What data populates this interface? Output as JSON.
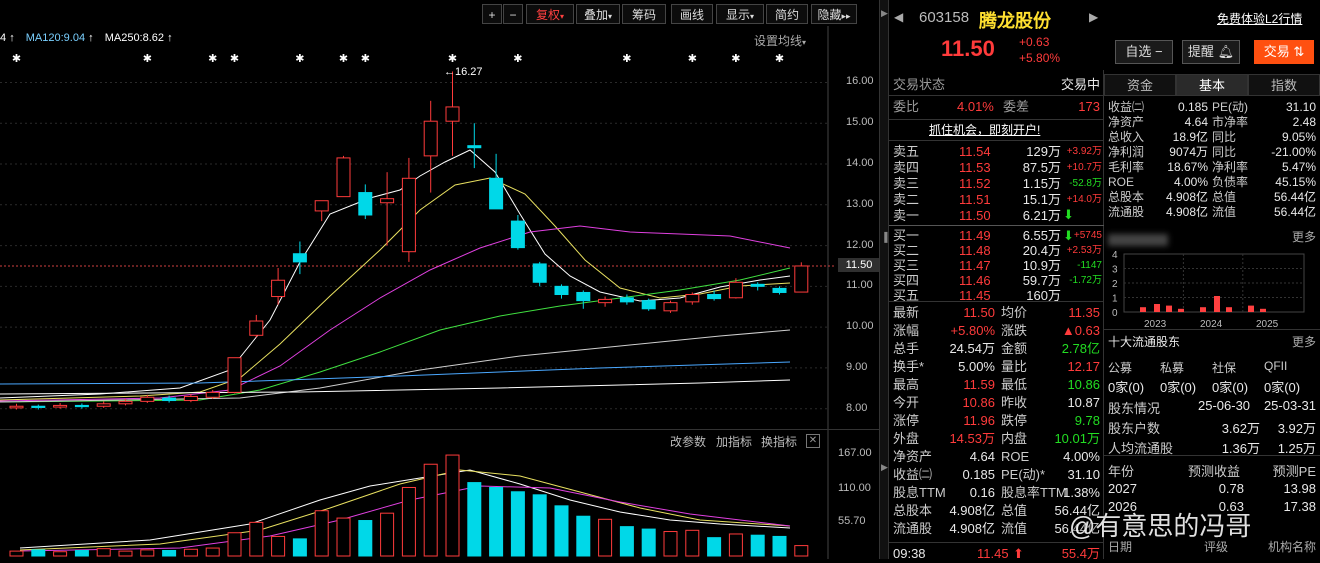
{
  "toolbar": {
    "plus": "+",
    "minus": "−",
    "fuquan": "复权",
    "diejia": "叠加",
    "chouma": "筹码",
    "huaxian": "画线",
    "xianshi": "显示",
    "jianyue": "简约",
    "yincang": "隐藏"
  },
  "ma_legend": {
    "ma_left": "4",
    "ma120": "MA120:9.04",
    "ma250": "MA250:8.62",
    "settings": "设置均线"
  },
  "price_axis": [
    "16.00",
    "15.00",
    "14.00",
    "13.00",
    "12.00",
    "11.00",
    "10.00",
    "9.00",
    "8.00"
  ],
  "current_price_tag": "11.50",
  "high_annotation": "←16.27",
  "volume_axis": [
    "167.00",
    "110.00",
    "55.70"
  ],
  "indicator_bar": {
    "change_params": "改参数",
    "add_indicator": "加指标",
    "switch_indicator": "换指标"
  },
  "chart_data": {
    "type": "candlestick",
    "price_range": [
      7.6,
      16.6
    ],
    "up_color": "#ff3b3b",
    "down_color": "#00d8e8",
    "candles": [
      {
        "o": 8.02,
        "c": 8.06,
        "h": 8.12,
        "l": 7.98
      },
      {
        "o": 8.06,
        "c": 8.03,
        "h": 8.1,
        "l": 7.98
      },
      {
        "o": 8.04,
        "c": 8.08,
        "h": 8.14,
        "l": 8.0
      },
      {
        "o": 8.08,
        "c": 8.05,
        "h": 8.13,
        "l": 8.0
      },
      {
        "o": 8.06,
        "c": 8.12,
        "h": 8.18,
        "l": 8.02
      },
      {
        "o": 8.12,
        "c": 8.18,
        "h": 8.24,
        "l": 8.08
      },
      {
        "o": 8.18,
        "c": 8.28,
        "h": 8.34,
        "l": 8.14
      },
      {
        "o": 8.26,
        "c": 8.2,
        "h": 8.32,
        "l": 8.15
      },
      {
        "o": 8.2,
        "c": 8.3,
        "h": 8.36,
        "l": 8.16
      },
      {
        "o": 8.28,
        "c": 8.4,
        "h": 8.46,
        "l": 8.24
      },
      {
        "o": 8.4,
        "c": 9.25,
        "h": 9.25,
        "l": 8.38
      },
      {
        "o": 9.8,
        "c": 10.15,
        "h": 10.3,
        "l": 9.75
      },
      {
        "o": 10.75,
        "c": 11.15,
        "h": 11.45,
        "l": 10.55
      },
      {
        "o": 11.8,
        "c": 11.6,
        "h": 12.1,
        "l": 11.3
      },
      {
        "o": 12.85,
        "c": 13.1,
        "h": 13.1,
        "l": 12.6
      },
      {
        "o": 13.2,
        "c": 14.15,
        "h": 14.2,
        "l": 13.2
      },
      {
        "o": 13.3,
        "c": 12.75,
        "h": 13.5,
        "l": 12.65
      },
      {
        "o": 13.05,
        "c": 13.15,
        "h": 13.8,
        "l": 12.0
      },
      {
        "o": 11.85,
        "c": 13.65,
        "h": 14.15,
        "l": 11.6
      },
      {
        "o": 14.2,
        "c": 15.05,
        "h": 15.55,
        "l": 13.3
      },
      {
        "o": 15.05,
        "c": 15.4,
        "h": 16.27,
        "l": 14.2
      },
      {
        "o": 14.45,
        "c": 14.4,
        "h": 15.0,
        "l": 13.9
      },
      {
        "o": 13.65,
        "c": 12.9,
        "h": 14.25,
        "l": 12.9
      },
      {
        "o": 12.6,
        "c": 11.95,
        "h": 12.75,
        "l": 11.9
      },
      {
        "o": 11.55,
        "c": 11.1,
        "h": 11.6,
        "l": 11.0
      },
      {
        "o": 11.0,
        "c": 10.8,
        "h": 11.05,
        "l": 10.7
      },
      {
        "o": 10.85,
        "c": 10.65,
        "h": 10.9,
        "l": 10.45
      },
      {
        "o": 10.6,
        "c": 10.68,
        "h": 10.75,
        "l": 10.5
      },
      {
        "o": 10.72,
        "c": 10.62,
        "h": 10.8,
        "l": 10.55
      },
      {
        "o": 10.65,
        "c": 10.45,
        "h": 10.7,
        "l": 10.4
      },
      {
        "o": 10.4,
        "c": 10.6,
        "h": 10.65,
        "l": 10.35
      },
      {
        "o": 10.62,
        "c": 10.8,
        "h": 10.85,
        "l": 10.55
      },
      {
        "o": 10.8,
        "c": 10.7,
        "h": 10.9,
        "l": 10.65
      },
      {
        "o": 10.72,
        "c": 11.1,
        "h": 11.2,
        "l": 10.7
      },
      {
        "o": 11.05,
        "c": 11.0,
        "h": 11.1,
        "l": 10.9
      },
      {
        "o": 10.95,
        "c": 10.85,
        "h": 11.0,
        "l": 10.8
      },
      {
        "o": 10.86,
        "c": 11.5,
        "h": 11.59,
        "l": 10.86
      }
    ],
    "volume_range": [
      0,
      170
    ],
    "volumes": [
      8,
      10,
      7,
      9,
      12,
      8,
      10,
      9,
      11,
      13,
      38,
      55,
      32,
      28,
      74,
      62,
      58,
      70,
      112,
      150,
      165,
      120,
      112,
      105,
      100,
      82,
      65,
      60,
      48,
      44,
      40,
      42,
      30,
      36,
      34,
      32,
      17
    ]
  },
  "header": {
    "code": "603158",
    "name": "腾龙股份",
    "free_l2": "免费体验L2行情",
    "price": "11.50",
    "change": "+0.63",
    "change_pct": "+5.80%",
    "zixuan": "自选",
    "tixing": "提醒",
    "jiaoyi": "交易"
  },
  "status": {
    "label": "交易状态",
    "value": "交易中"
  },
  "weibi": {
    "label": "委比",
    "value": "4.01%",
    "label2": "委差",
    "value2": "173"
  },
  "ad_banner": "抓住机会，即刻开户!",
  "asks": [
    {
      "label": "卖五",
      "price": "11.54",
      "vol": "129万",
      "delta": "+3.92万"
    },
    {
      "label": "卖四",
      "price": "11.53",
      "vol": "87.5万",
      "delta": "+10.7万"
    },
    {
      "label": "卖三",
      "price": "11.52",
      "vol": "1.15万",
      "delta": "-52.8万"
    },
    {
      "label": "卖二",
      "price": "11.51",
      "vol": "15.1万",
      "delta": "+14.0万"
    },
    {
      "label": "卖一",
      "price": "11.50",
      "vol": "6.21万",
      "delta": ""
    }
  ],
  "bids": [
    {
      "label": "买一",
      "price": "11.49",
      "vol": "6.55万",
      "delta": "+5745"
    },
    {
      "label": "买二",
      "price": "11.48",
      "vol": "20.4万",
      "delta": "+2.53万"
    },
    {
      "label": "买三",
      "price": "11.47",
      "vol": "10.9万",
      "delta": "-1147"
    },
    {
      "label": "买四",
      "price": "11.46",
      "vol": "59.7万",
      "delta": "-1.72万"
    },
    {
      "label": "买五",
      "price": "11.45",
      "vol": "160万",
      "delta": ""
    }
  ],
  "stats": [
    {
      "l1": "最新",
      "v1": "11.50",
      "l2": "均价",
      "v2": "11.35"
    },
    {
      "l1": "涨幅",
      "v1": "+5.80%",
      "l2": "涨跌",
      "v2": "▲0.63"
    },
    {
      "l1": "总手",
      "v1": "24.54万",
      "l2": "金额",
      "v2": "2.78亿"
    },
    {
      "l1": "换手*",
      "v1": "5.00%",
      "l2": "量比",
      "v2": "12.17"
    },
    {
      "l1": "最高",
      "v1": "11.59",
      "l2": "最低",
      "v2": "10.86"
    },
    {
      "l1": "今开",
      "v1": "10.86",
      "l2": "昨收",
      "v2": "10.87"
    },
    {
      "l1": "涨停",
      "v1": "11.96",
      "l2": "跌停",
      "v2": "9.78"
    },
    {
      "l1": "外盘",
      "v1": "14.53万",
      "l2": "内盘",
      "v2": "10.01万"
    },
    {
      "l1": "净资产",
      "v1": "4.64",
      "l2": "ROE",
      "v2": "4.00%"
    },
    {
      "l1": "收益㈡",
      "v1": "0.185",
      "l2": "PE(动)*",
      "v2": "31.10"
    },
    {
      "l1": "股息TTM",
      "v1": "0.16",
      "l2": "股息率TTM",
      "v2": "1.38%"
    },
    {
      "l1": "总股本",
      "v1": "4.908亿",
      "l2": "总值",
      "v2": "56.44亿"
    },
    {
      "l1": "流通股",
      "v1": "4.908亿",
      "l2": "流值",
      "v2": "56.44亿"
    }
  ],
  "tick": {
    "time": "09:38",
    "price": "11.45",
    "vol": "55.4万"
  },
  "fund_tabs": [
    "资金",
    "基本",
    "指数"
  ],
  "fund_rows": [
    {
      "l1": "收益㈡",
      "v1": "0.185",
      "l2": "PE(动)",
      "v2": "31.10"
    },
    {
      "l1": "净资产",
      "v1": "4.64",
      "l2": "市净率",
      "v2": "2.48"
    },
    {
      "l1": "总收入",
      "v1": "18.9亿",
      "l2": "同比",
      "v2": "9.05%"
    },
    {
      "l1": "净利润",
      "v1": "9074万",
      "l2": "同比",
      "v2": "-21.00%"
    },
    {
      "l1": "毛利率",
      "v1": "18.67%",
      "l2": "净利率",
      "v2": "5.47%"
    },
    {
      "l1": "ROE",
      "v1": "4.00%",
      "l2": "负债率",
      "v2": "45.15%"
    },
    {
      "l1": "总股本",
      "v1": "4.908亿",
      "l2": "总值",
      "v2": "56.44亿"
    },
    {
      "l1": "流通股",
      "v1": "4.908亿",
      "l2": "流值",
      "v2": "56.44亿"
    }
  ],
  "more": "更多",
  "mini_chart": {
    "y_ticks": [
      "4",
      "3",
      "2",
      "1",
      "0"
    ],
    "x_ticks": [
      "2023",
      "2024",
      "2025"
    ],
    "bars": [
      0.3,
      0.5,
      0.4,
      0.2,
      0.3,
      1.0,
      0.3,
      0.4,
      0.2
    ]
  },
  "holders": {
    "title": "十大流通股东",
    "types": [
      "公募",
      "私募",
      "社保",
      "QFII"
    ],
    "counts": [
      "0家(0)",
      "0家(0)",
      "0家(0)",
      "0家(0)"
    ]
  },
  "holder_info": {
    "label": "股东情况",
    "d1": "25-06-30",
    "d2": "25-03-31",
    "rows": [
      {
        "l": "股东户数",
        "v1": "3.62万",
        "v2": "3.92万"
      },
      {
        "l": "人均流通股",
        "v1": "1.36万",
        "v2": "1.25万"
      }
    ]
  },
  "forecast": {
    "headers": [
      "年份",
      "预测收益",
      "预测PE"
    ],
    "rows": [
      {
        "y": "2027",
        "e": "0.78",
        "pe": "13.98"
      },
      {
        "y": "2026",
        "e": "0.63",
        "pe": "17.38"
      }
    ],
    "footer": [
      "日期",
      "评级",
      "机构名称"
    ]
  },
  "watermark": "@有意思的冯哥"
}
